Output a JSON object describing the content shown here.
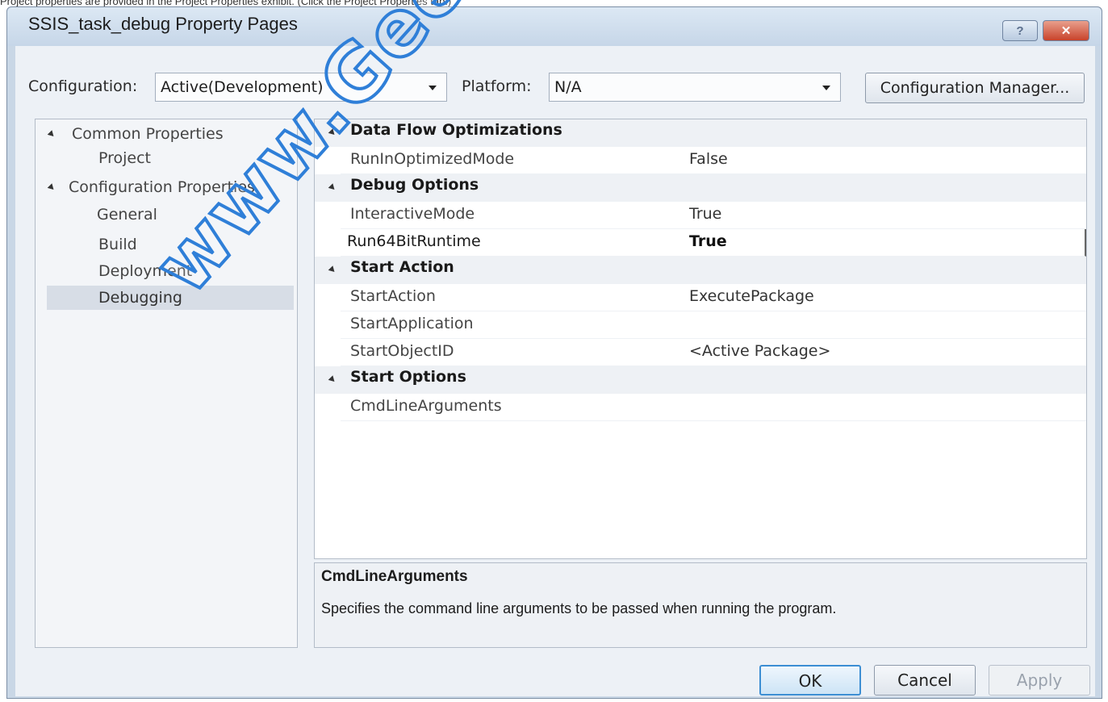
{
  "caption": "Project properties are provided in the Project Properties exhibit. (Click the Project Properties tab.)",
  "window": {
    "title": "SSIS_task_debug Property Pages",
    "help_label": "?",
    "close_label": "✕"
  },
  "config_bar": {
    "configuration_label": "Configuration:",
    "configuration_value": "Active(Development)",
    "platform_label": "Platform:",
    "platform_value": "N/A",
    "manager_label": "Configuration Manager..."
  },
  "tree": {
    "items": [
      {
        "label": "Common Properties"
      },
      {
        "label": "Project"
      },
      {
        "label": "Configuration Properties"
      },
      {
        "label": "General"
      },
      {
        "label": "Build"
      },
      {
        "label": "Deployment"
      },
      {
        "label": "Debugging"
      }
    ]
  },
  "grid": {
    "categories": [
      {
        "label": "Data Flow Optimizations"
      },
      {
        "label": "Debug Options"
      },
      {
        "label": "Start Action"
      },
      {
        "label": "Start Options"
      }
    ],
    "properties": [
      {
        "name": "RunInOptimizedMode",
        "value": "False"
      },
      {
        "name": "InteractiveMode",
        "value": "True"
      },
      {
        "name": "Run64BitRuntime",
        "value": "True"
      },
      {
        "name": "StartAction",
        "value": "ExecutePackage"
      },
      {
        "name": "StartApplication",
        "value": ""
      },
      {
        "name": "StartObjectID",
        "value": "<Active Package>"
      },
      {
        "name": "CmdLineArguments",
        "value": ""
      }
    ]
  },
  "description": {
    "title": "CmdLineArguments",
    "text": "Specifies the command line arguments to be passed when running the program."
  },
  "buttons": {
    "ok": "OK",
    "cancel": "Cancel",
    "apply": "Apply"
  },
  "watermark": "www.GeekCert",
  "colors": {
    "accent": "#3c8ed3",
    "watermark": "#2f7fd8",
    "selection": "#d7dde6"
  }
}
